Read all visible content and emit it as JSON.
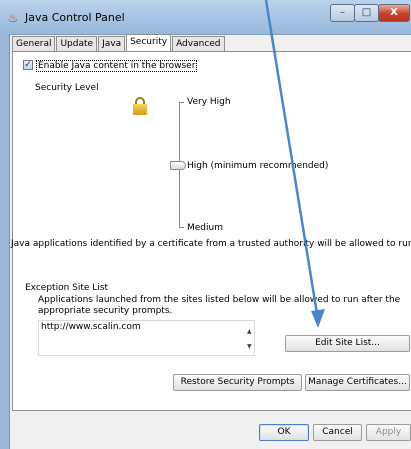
{
  "window": {
    "title": "Java Control Panel",
    "icon": "java-cup-icon",
    "controls": {
      "minimize": "–",
      "maximize": "□",
      "close": "X"
    }
  },
  "tabs": [
    {
      "label": "General",
      "active": false
    },
    {
      "label": "Update",
      "active": false
    },
    {
      "label": "Java",
      "active": false
    },
    {
      "label": "Security",
      "active": true
    },
    {
      "label": "Advanced",
      "active": false
    }
  ],
  "security": {
    "enable_checkbox": {
      "label": "Enable Java content in the browser",
      "checked": true,
      "mark": "✓"
    },
    "security_level_heading": "Security Level",
    "levels": {
      "very_high": "Very High",
      "high": "High (minimum recommended)",
      "medium": "Medium"
    },
    "selected_level": "high",
    "lock_icon": "padlock-icon",
    "trusted_note": "Java applications identified by a certificate from a trusted authority will be allowed to run.",
    "exception_heading": "Exception Site List",
    "exception_description": "Applications launched from the sites listed below will be allowed to run after the appropriate security prompts.",
    "exception_sites": [
      "http://www.scalin.com"
    ],
    "scroll_up": "▲",
    "scroll_down": "▼",
    "edit_site_list_button": "Edit Site List...",
    "restore_prompts_button": "Restore Security Prompts",
    "manage_certificates_button": "Manage Certificates..."
  },
  "footer": {
    "ok_button": "OK",
    "cancel_button": "Cancel",
    "apply_button": "Apply",
    "apply_enabled": false
  },
  "annotation": {
    "arrow_color": "#4a86c8",
    "icon": "annotation-arrow-icon"
  }
}
